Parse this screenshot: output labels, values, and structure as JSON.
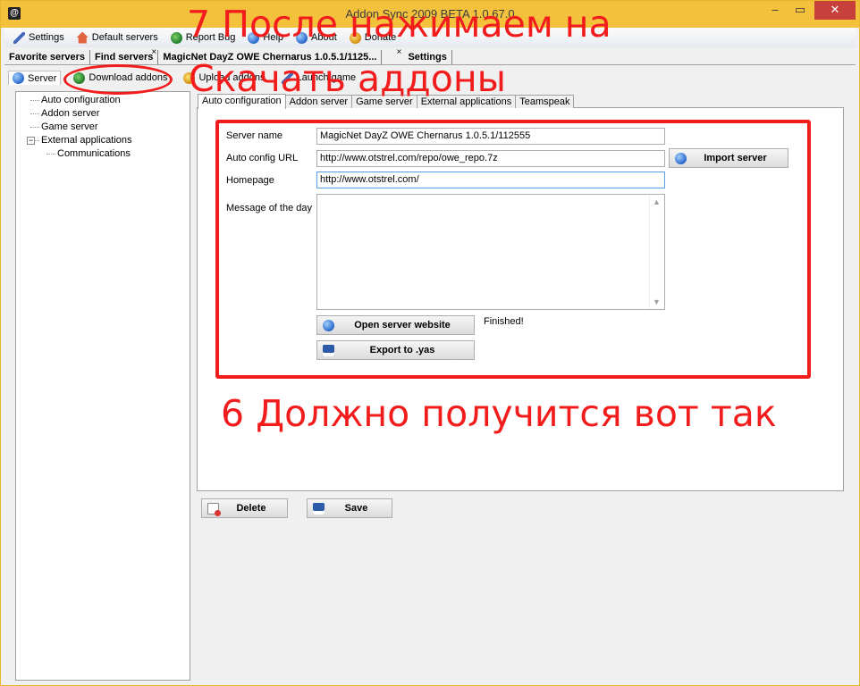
{
  "window": {
    "title": "Addon Sync 2009 BETA 1.0.67.0",
    "app_icon": "@",
    "minimize": "–",
    "maximize": "▭",
    "close": "✕"
  },
  "toolbar": {
    "settings": "Settings",
    "default_servers": "Default servers",
    "report_bug": "Report Bug",
    "help": "Help",
    "about": "About",
    "donate": "Donate"
  },
  "tabs": {
    "favorite_servers": "Favorite servers",
    "find_servers": "Find servers",
    "server_tab": "MagicNet DayZ OWE Chernarus 1.0.5.1/1125...",
    "settings": "Settings",
    "close_glyph": "×"
  },
  "subtoolbar": {
    "server": "Server",
    "download_addons": "Download addons",
    "upload_addons": "Upload addons",
    "launch_game": "Launch game"
  },
  "tree": {
    "auto_configuration": "Auto configuration",
    "addon_server": "Addon server",
    "game_server": "Game server",
    "external_applications": "External applications",
    "communications": "Communications",
    "expander": "−"
  },
  "inner_tabs": [
    "Auto configuration",
    "Addon server",
    "Game server",
    "External applications",
    "Teamspeak"
  ],
  "form": {
    "server_name_label": "Server name",
    "server_name_value": "MagicNet DayZ OWE Chernarus 1.0.5.1/112555",
    "auto_config_url_label": "Auto config URL",
    "auto_config_url_value": "http://www.otstrel.com/repo/owe_repo.7z",
    "homepage_label": "Homepage",
    "homepage_value": "http://www.otstrel.com/",
    "motd_label": "Message of the day",
    "motd_value": "",
    "import_server": "Import server",
    "open_server_website": "Open server website",
    "export_yas": "Export to .yas",
    "status": "Finished!"
  },
  "actions": {
    "delete": "Delete",
    "save": "Save"
  },
  "annotations": {
    "step7_line1": "7 После нажимаем на",
    "step7_line2": "Скачать аддоны",
    "step6": "6 Должно получится вот так"
  },
  "colors": {
    "titlebar": "#f3c13c",
    "annotation_red": "#f21c1c",
    "close_button": "#c7403b"
  }
}
